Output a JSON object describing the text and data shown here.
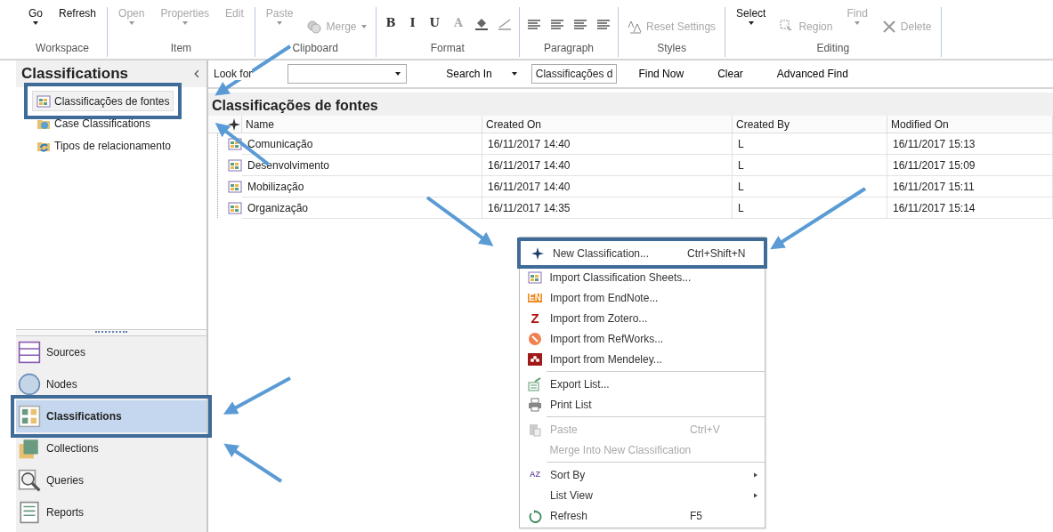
{
  "ribbon": {
    "groups": [
      {
        "label": "Workspace",
        "items": [
          {
            "kind": "text",
            "label": "Go",
            "dropdown": true,
            "disabled": false
          },
          {
            "kind": "text",
            "label": "Refresh",
            "dropdown": false,
            "disabled": false
          }
        ]
      },
      {
        "label": "Item",
        "items": [
          {
            "kind": "text",
            "label": "Open",
            "dropdown": true,
            "disabled": true
          },
          {
            "kind": "text",
            "label": "Properties",
            "dropdown": true,
            "disabled": true
          },
          {
            "kind": "text",
            "label": "Edit",
            "dropdown": false,
            "disabled": true
          }
        ]
      },
      {
        "label": "Clipboard",
        "items": [
          {
            "kind": "text",
            "label": "Paste",
            "dropdown": true,
            "disabled": true
          },
          {
            "kind": "merge",
            "label": "Merge",
            "dropdown": true,
            "disabled": true
          }
        ]
      },
      {
        "label": "Format",
        "items": [
          {
            "kind": "glyph",
            "label": "B",
            "disabled": false
          },
          {
            "kind": "glyph",
            "label": "I",
            "disabled": false
          },
          {
            "kind": "glyph",
            "label": "U",
            "disabled": false
          },
          {
            "kind": "fontcolor",
            "label": "A",
            "disabled": true
          },
          {
            "kind": "highlight",
            "disabled": false
          },
          {
            "kind": "line",
            "disabled": true
          }
        ]
      },
      {
        "label": "Paragraph",
        "items": [
          {
            "kind": "align",
            "disabled": false
          },
          {
            "kind": "align",
            "disabled": false
          },
          {
            "kind": "align",
            "disabled": false
          },
          {
            "kind": "align",
            "disabled": false
          }
        ]
      },
      {
        "label": "Styles",
        "items": [
          {
            "kind": "reset",
            "label": "Reset Settings",
            "disabled": true
          }
        ]
      },
      {
        "label": "Editing",
        "items": [
          {
            "kind": "text",
            "label": "Select",
            "dropdown": true,
            "disabled": false
          },
          {
            "kind": "region",
            "label": "Region",
            "disabled": true
          },
          {
            "kind": "text",
            "label": "Find",
            "dropdown": true,
            "disabled": true
          },
          {
            "kind": "delete",
            "label": "Delete",
            "disabled": true
          }
        ]
      }
    ]
  },
  "navigator": {
    "title": "Classifications",
    "items": [
      {
        "label": "Classificações de fontes",
        "kind": "source-class",
        "selected": true,
        "highlighted": true
      },
      {
        "label": "Case Classifications",
        "kind": "case-class",
        "selected": false,
        "highlighted": false
      },
      {
        "label": "Tipos de relacionamento",
        "kind": "relation",
        "selected": false,
        "highlighted": false
      }
    ]
  },
  "sections": [
    {
      "label": "Sources",
      "kind": "sources",
      "selected": false,
      "highlighted": false
    },
    {
      "label": "Nodes",
      "kind": "nodes",
      "selected": false,
      "highlighted": false
    },
    {
      "label": "Classifications",
      "kind": "classifications",
      "selected": true,
      "highlighted": true
    },
    {
      "label": "Collections",
      "kind": "collections",
      "selected": false,
      "highlighted": false
    },
    {
      "label": "Queries",
      "kind": "queries",
      "selected": false,
      "highlighted": false
    },
    {
      "label": "Reports",
      "kind": "reports",
      "selected": false,
      "highlighted": false
    }
  ],
  "find_bar": {
    "look_for_label": "Look for",
    "search_in_label": "Search In",
    "search_in_value": "Classificações d",
    "buttons": [
      "Find Now",
      "Clear",
      "Advanced Find"
    ]
  },
  "list": {
    "title": "Classificações de fontes",
    "columns": [
      "Name",
      "Created On",
      "Created By",
      "Modified On"
    ],
    "rows": [
      [
        "Comunicação",
        "16/11/2017 14:40",
        "L",
        "16/11/2017 15:13"
      ],
      [
        "Desenvolvimento",
        "16/11/2017 14:40",
        "L",
        "16/11/2017 15:09"
      ],
      [
        "Mobilização",
        "16/11/2017 14:40",
        "L",
        "16/11/2017 15:11"
      ],
      [
        "Organização",
        "16/11/2017 14:35",
        "L",
        "16/11/2017 15:14"
      ]
    ]
  },
  "context_menu": [
    {
      "kind": "star",
      "label": "New Classification...",
      "shortcut": "Ctrl+Shift+N",
      "disabled": false,
      "submenu": false,
      "highlighted": true
    },
    {
      "kind": "sheet",
      "label": "Import Classification Sheets...",
      "disabled": false,
      "submenu": false,
      "highlighted": false
    },
    {
      "kind": "en",
      "label": "Import from EndNote...",
      "badge": "EN",
      "disabled": false,
      "submenu": false,
      "highlighted": false
    },
    {
      "kind": "z",
      "label": "Import from Zotero...",
      "badge": "Z",
      "disabled": false,
      "submenu": false,
      "highlighted": false
    },
    {
      "kind": "refworks",
      "label": "Import from RefWorks...",
      "disabled": false,
      "submenu": false,
      "highlighted": false
    },
    {
      "kind": "mendeley",
      "label": "Import from Mendeley...",
      "disabled": false,
      "submenu": false,
      "highlighted": false
    },
    {
      "kind": "separator"
    },
    {
      "kind": "export",
      "label": "Export List...",
      "disabled": false,
      "submenu": false,
      "highlighted": false
    },
    {
      "kind": "print",
      "label": "Print List",
      "disabled": false,
      "submenu": false,
      "highlighted": false
    },
    {
      "kind": "separator"
    },
    {
      "kind": "paste",
      "label": "Paste",
      "shortcut": "Ctrl+V",
      "disabled": true,
      "submenu": false,
      "highlighted": false
    },
    {
      "kind": "plain",
      "label": "Merge Into New Classification",
      "disabled": true,
      "submenu": false,
      "highlighted": false
    },
    {
      "kind": "separator"
    },
    {
      "kind": "sort",
      "label": "Sort By",
      "badge": "AZ",
      "disabled": false,
      "submenu": true,
      "highlighted": false
    },
    {
      "kind": "plain",
      "label": "List View",
      "disabled": false,
      "submenu": true,
      "highlighted": false
    },
    {
      "kind": "refresh",
      "label": "Refresh",
      "shortcut": "F5",
      "disabled": false,
      "submenu": false,
      "highlighted": false
    }
  ]
}
